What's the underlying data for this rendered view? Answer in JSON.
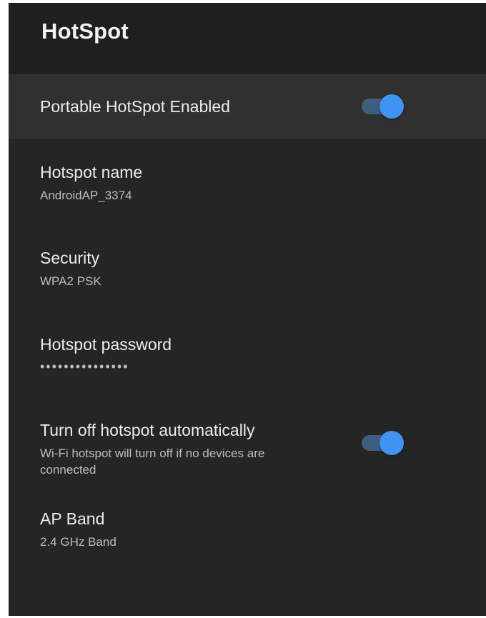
{
  "header": {
    "title": "HotSpot"
  },
  "settings": [
    {
      "title": "Portable HotSpot Enabled",
      "subtitle": "",
      "toggle": true,
      "toggle_on": true
    },
    {
      "title": "Hotspot name",
      "subtitle": "AndroidAP_3374"
    },
    {
      "title": "Security",
      "subtitle": "WPA2 PSK"
    },
    {
      "title": "Hotspot password",
      "subtitle": "•••••••••••••••"
    },
    {
      "title": "Turn off hotspot automatically",
      "subtitle": "Wi-Fi hotspot will turn off if no devices are connected",
      "toggle": true,
      "toggle_on": true
    },
    {
      "title": "AP Band",
      "subtitle": "2.4 GHz Band"
    }
  ],
  "colors": {
    "background": "#252525",
    "header_background": "#1f1f1f",
    "focused_row": "#303030",
    "toggle_thumb": "#3f94f2",
    "toggle_track": "#3e5e80"
  }
}
